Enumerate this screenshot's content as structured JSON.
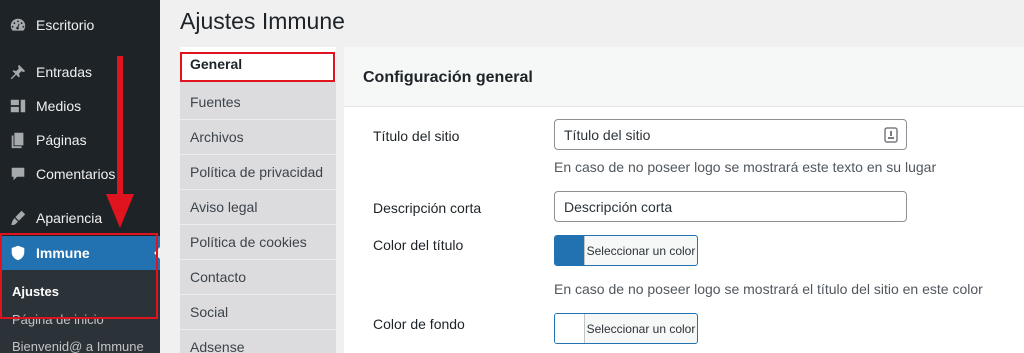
{
  "sidebar": {
    "items": [
      {
        "label": "Escritorio",
        "icon": "dashboard-icon"
      },
      {
        "label": "Entradas",
        "icon": "pin-icon"
      },
      {
        "label": "Medios",
        "icon": "media-icon"
      },
      {
        "label": "Páginas",
        "icon": "pages-icon"
      },
      {
        "label": "Comentarios",
        "icon": "comments-icon"
      },
      {
        "label": "Apariencia",
        "icon": "appearance-icon"
      },
      {
        "label": "Immune",
        "icon": "shield-icon"
      }
    ],
    "submenu": [
      "Ajustes",
      "Página de inicio",
      "Bienvenid@ a Immune"
    ]
  },
  "page": {
    "title": "Ajustes Immune"
  },
  "tabs": [
    "General",
    "Fuentes",
    "Archivos",
    "Política de privacidad",
    "Aviso legal",
    "Política de cookies",
    "Contacto",
    "Social",
    "Adsense"
  ],
  "section": {
    "title": "Configuración general"
  },
  "fields": {
    "site_title": {
      "label": "Título del sitio",
      "value": "Título del sitio",
      "help": "En caso de no poseer logo se mostrará este texto en su lugar"
    },
    "short_desc": {
      "label": "Descripción corta",
      "value": "Descripción corta"
    },
    "title_color": {
      "label": "Color del título",
      "button": "Seleccionar un color",
      "color": "#2271b1",
      "help": "En caso de no poseer logo se mostrará el título del sitio en este color"
    },
    "bg_color": {
      "label": "Color de fondo",
      "button": "Seleccionar un color",
      "color": "#ffffff"
    }
  },
  "colors": {
    "sidebar_bg": "#1d2327",
    "accent": "#2271b1",
    "annotation": "#e0141e"
  }
}
